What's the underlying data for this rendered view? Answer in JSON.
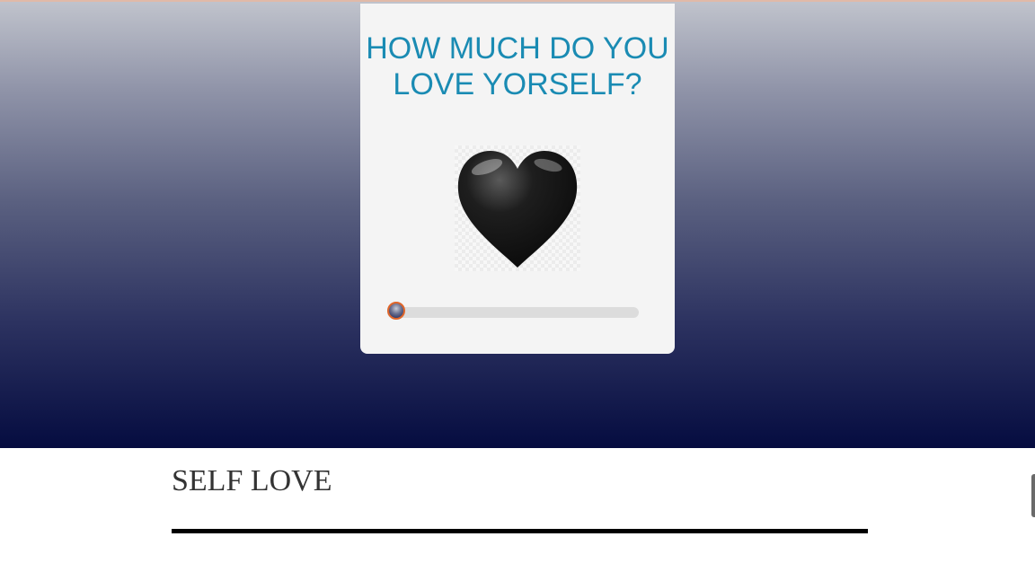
{
  "card": {
    "question": "HOW MUCH DO YOU LOVE YORSELF?",
    "heart_icon": "black-heart-icon",
    "slider": {
      "min": 0,
      "max": 100,
      "value": 0
    }
  },
  "section": {
    "title": "SELF LOVE"
  },
  "colors": {
    "question_text": "#1a8bb3",
    "card_background": "#f4f4f4",
    "slider_thumb_border": "#e0662a",
    "gradient_top": "#c0c3cc",
    "gradient_bottom": "#050c40"
  }
}
